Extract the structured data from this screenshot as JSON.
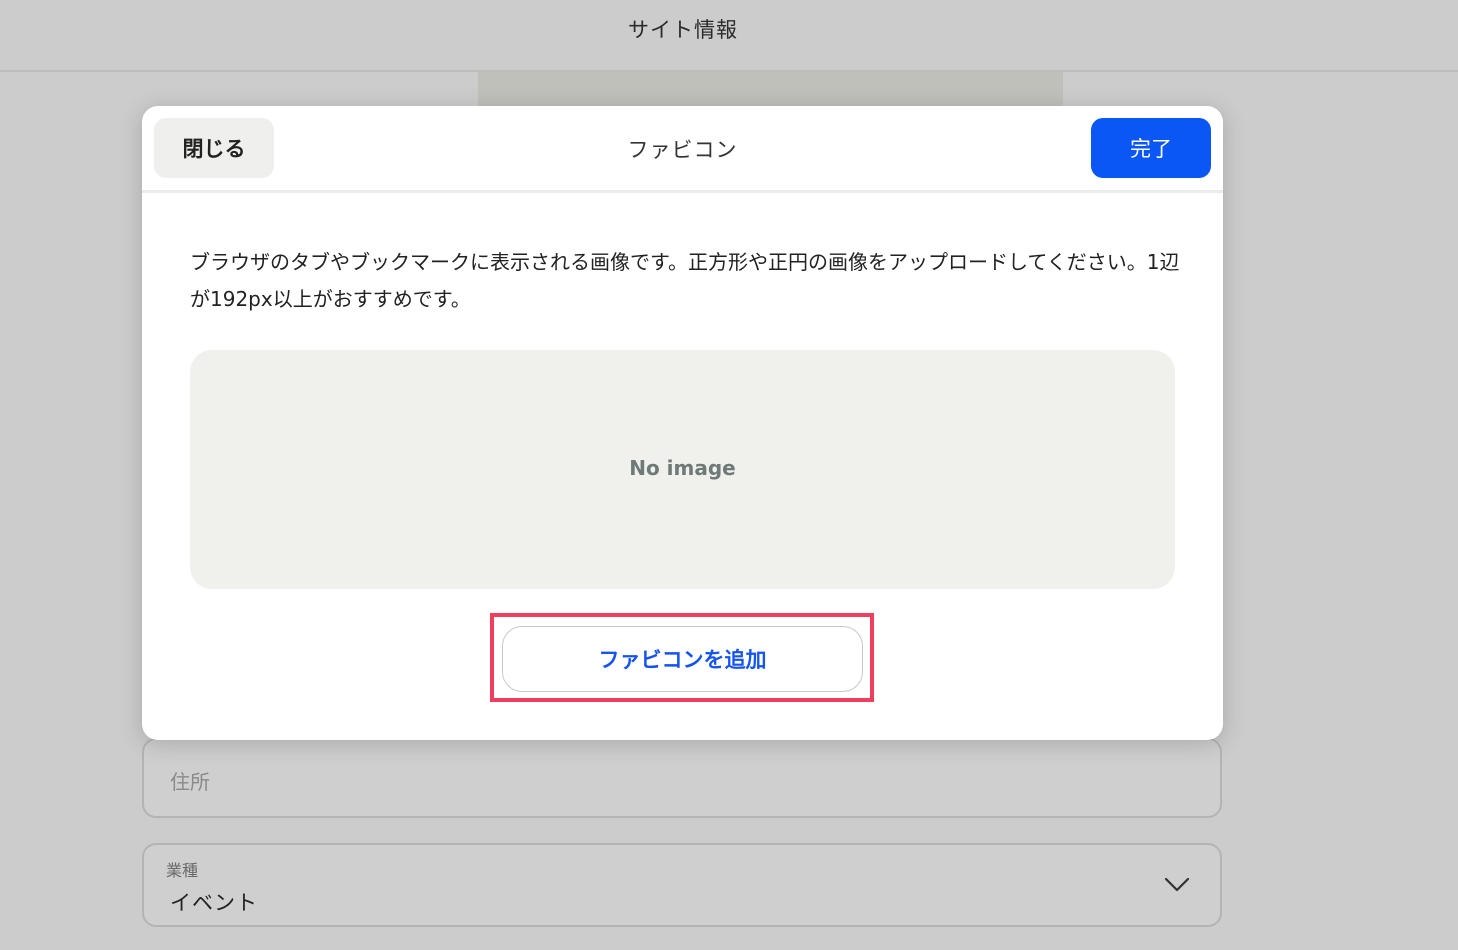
{
  "header": {
    "title": "サイト情報"
  },
  "background_form": {
    "address": {
      "placeholder": "住所"
    },
    "industry": {
      "label": "業種",
      "value": "イベント",
      "icon": "chevron-down-icon"
    }
  },
  "modal": {
    "close_label": "閉じる",
    "title": "ファビコン",
    "done_label": "完了",
    "description": "ブラウザのタブやブックマークに表示される画像です。正方形や正円の画像をアップロードしてください。1辺が192px以上がおすすめです。",
    "preview_placeholder": "No image",
    "add_button_label": "ファビコンを追加"
  },
  "colors": {
    "accent": "#0b57f5",
    "add_text": "#1554f0",
    "highlight": "#ef3e5e",
    "overlay": "#cccccc"
  }
}
